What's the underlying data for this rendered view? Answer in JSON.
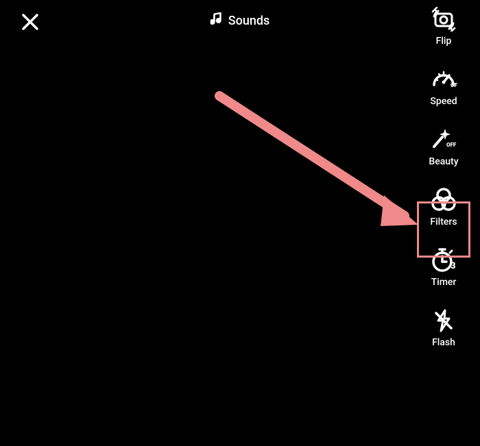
{
  "header": {
    "sounds_label": "Sounds"
  },
  "rail": {
    "flip": {
      "label": "Flip"
    },
    "speed": {
      "label": "Speed",
      "badge": "OFF"
    },
    "beauty": {
      "label": "Beauty",
      "badge": "OFF"
    },
    "filters": {
      "label": "Filters"
    },
    "timer": {
      "label": "Timer",
      "badge": "3"
    },
    "flash": {
      "label": "Flash"
    }
  },
  "annotation": {
    "arrow_color": "#f08a8a",
    "highlight_color": "#f08a8a"
  }
}
